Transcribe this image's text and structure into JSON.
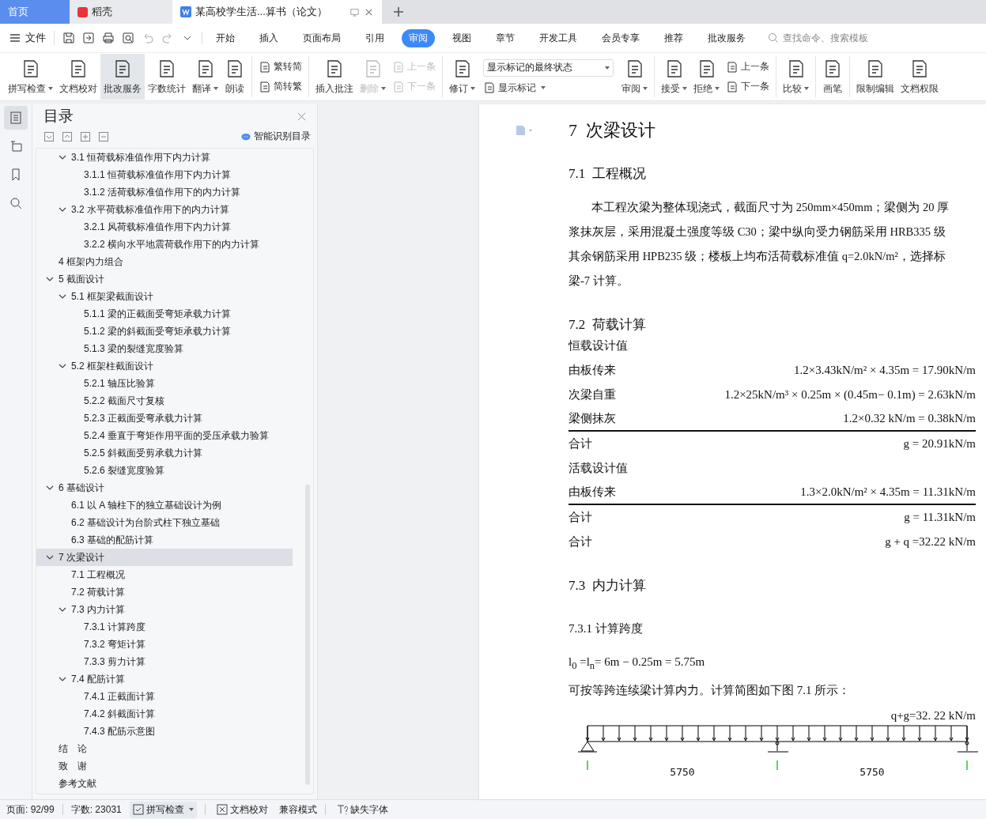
{
  "tabs": [
    {
      "label": "首页",
      "kind": "home",
      "selected": false
    },
    {
      "label": "稻壳",
      "kind": "app",
      "selected": false
    },
    {
      "label": "某高校学生活...算书（论文）",
      "kind": "doc",
      "selected": true
    }
  ],
  "menu": {
    "file": "文件",
    "tabs": [
      {
        "label": "开始",
        "selected": false
      },
      {
        "label": "插入",
        "selected": false
      },
      {
        "label": "页面布局",
        "selected": false
      },
      {
        "label": "引用",
        "selected": false
      },
      {
        "label": "审阅",
        "selected": true
      },
      {
        "label": "视图",
        "selected": false
      },
      {
        "label": "章节",
        "selected": false
      },
      {
        "label": "开发工具",
        "selected": false
      },
      {
        "label": "会员专享",
        "selected": false
      },
      {
        "label": "推荐",
        "selected": false
      },
      {
        "label": "批改服务",
        "selected": false
      }
    ],
    "search": {
      "placeholder": "查找命令、搜索模板"
    }
  },
  "ribbon": [
    {
      "kind": "large",
      "label": "拼写检查",
      "dropdown": true,
      "selected": false,
      "disabled": false
    },
    {
      "kind": "large",
      "label": "文档校对",
      "dropdown": false,
      "selected": false,
      "disabled": false
    },
    {
      "kind": "large",
      "label": "批改服务",
      "dropdown": false,
      "selected": true,
      "disabled": false
    },
    {
      "kind": "large",
      "label": "字数统计",
      "dropdown": false,
      "selected": false,
      "disabled": false
    },
    {
      "kind": "large",
      "label": "翻译",
      "dropdown": true,
      "selected": false,
      "disabled": false
    },
    {
      "kind": "large",
      "label": "朗读",
      "dropdown": false,
      "selected": false,
      "disabled": false
    },
    {
      "kind": "divider"
    },
    {
      "kind": "stack",
      "items": [
        {
          "label": "繁转简",
          "disabled": false
        },
        {
          "label": "简转繁",
          "disabled": false
        }
      ]
    },
    {
      "kind": "divider"
    },
    {
      "kind": "large",
      "label": "插入批注",
      "dropdown": false,
      "selected": false,
      "disabled": false
    },
    {
      "kind": "large",
      "label": "删除",
      "dropdown": true,
      "selected": false,
      "disabled": true
    },
    {
      "kind": "stack",
      "items": [
        {
          "label": "上一条",
          "disabled": true
        },
        {
          "label": "下一条",
          "disabled": true
        }
      ]
    },
    {
      "kind": "divider"
    },
    {
      "kind": "large",
      "label": "修订",
      "dropdown": true,
      "selected": false,
      "disabled": false
    },
    {
      "kind": "select",
      "value": "显示标记的最终状态",
      "sub": "显示标记"
    },
    {
      "kind": "large",
      "label": "审阅",
      "dropdown": true,
      "selected": false,
      "disabled": false
    },
    {
      "kind": "divider"
    },
    {
      "kind": "large",
      "label": "接受",
      "dropdown": true,
      "selected": false,
      "disabled": false
    },
    {
      "kind": "large",
      "label": "拒绝",
      "dropdown": true,
      "selected": false,
      "disabled": false
    },
    {
      "kind": "stack",
      "items": [
        {
          "label": "上一条",
          "disabled": false
        },
        {
          "label": "下一条",
          "disabled": false
        }
      ]
    },
    {
      "kind": "divider"
    },
    {
      "kind": "large",
      "label": "比较",
      "dropdown": true,
      "selected": false,
      "disabled": false
    },
    {
      "kind": "divider"
    },
    {
      "kind": "large",
      "label": "画笔",
      "dropdown": false,
      "selected": false,
      "disabled": false
    },
    {
      "kind": "divider"
    },
    {
      "kind": "large",
      "label": "限制编辑",
      "dropdown": false,
      "selected": false,
      "disabled": false
    },
    {
      "kind": "large",
      "label": "文档权限",
      "dropdown": false,
      "selected": false,
      "disabled": false
    }
  ],
  "rail": [
    {
      "selected": true
    },
    {
      "selected": false
    },
    {
      "selected": false
    },
    {
      "selected": false
    }
  ],
  "outline": {
    "title": "目录",
    "smart": "智能识别目录",
    "toc": [
      {
        "children": [
          {
            "label": "3.1 恒荷载标准值作用下内力计算",
            "selected": false,
            "expanded": true,
            "children": [
              {
                "label": "3.1.1 恒荷载标准值作用下内力计算",
                "selected": false
              },
              {
                "label": "3.1.2 活荷载标准值作用下的内力计算",
                "selected": false
              }
            ]
          },
          {
            "label": "3.2 水平荷载标准值作用下的内力计算",
            "selected": false,
            "expanded": true,
            "children": [
              {
                "label": "3.2.1 风荷载标准值作用下内力计算",
                "selected": false
              },
              {
                "label": "3.2.2 横向水平地震荷载作用下的内力计算",
                "selected": false
              }
            ]
          }
        ]
      },
      {
        "label": "4 框架内力组合",
        "selected": false
      },
      {
        "label": "5 截面设计",
        "selected": false,
        "expanded": true,
        "children": [
          {
            "label": "5.1 框架梁截面设计",
            "selected": false,
            "expanded": true,
            "children": [
              {
                "label": "5.1.1 梁的正截面受弯矩承载力计算",
                "selected": false
              },
              {
                "label": "5.1.2 梁的斜截面受弯矩承载力计算",
                "selected": false
              },
              {
                "label": "5.1.3 梁的裂缝宽度验算",
                "selected": false
              }
            ]
          },
          {
            "label": "5.2 框架柱截面设计",
            "selected": false,
            "expanded": true,
            "children": [
              {
                "label": "5.2.1 轴压比验算",
                "selected": false
              },
              {
                "label": "5.2.2 截面尺寸复核",
                "selected": false
              },
              {
                "label": "5.2.3 正截面受弯承载力计算",
                "selected": false
              },
              {
                "label": "5.2.4 垂直于弯矩作用平面的受压承载力验算",
                "selected": false
              },
              {
                "label": "5.2.5 斜截面受剪承载力计算",
                "selected": false
              },
              {
                "label": "5.2.6 裂缝宽度验算",
                "selected": false
              }
            ]
          }
        ]
      },
      {
        "label": "6 基础设计",
        "selected": false,
        "expanded": true,
        "children": [
          {
            "label": "6.1 以 A 轴柱下的独立基础设计为例",
            "selected": false
          },
          {
            "label": "6.2 基础设计为台阶式柱下独立基础",
            "selected": false
          },
          {
            "label": "6.3 基础的配筋计算",
            "selected": false
          }
        ]
      },
      {
        "label": "7 次梁设计",
        "selected": true,
        "expanded": true,
        "children": [
          {
            "label": "7.1 工程概况",
            "selected": false
          },
          {
            "label": "7.2 荷载计算",
            "selected": false
          },
          {
            "label": "7.3 内力计算",
            "selected": false,
            "expanded": true,
            "children": [
              {
                "label": "7.3.1 计算跨度",
                "selected": false
              },
              {
                "label": "7.3.2 弯矩计算",
                "selected": false
              },
              {
                "label": "7.3.3 剪力计算",
                "selected": false
              }
            ]
          },
          {
            "label": "7.4 配筋计算",
            "selected": false,
            "expanded": true,
            "children": [
              {
                "label": "7.4.1 正截面计算",
                "selected": false
              },
              {
                "label": "7.4.2 斜截面计算",
                "selected": false
              },
              {
                "label": "7.4.3 配筋示意图",
                "selected": false
              }
            ]
          }
        ]
      },
      {
        "label": "结　论",
        "selected": false
      },
      {
        "label": "致　谢",
        "selected": false
      },
      {
        "label": "参考文献",
        "selected": false
      }
    ]
  },
  "document": {
    "chapter": "7  次梁设计",
    "s1": {
      "heading": "7.1  工程概况",
      "lines": [
        "本工程次梁为整体现浇式，截面尺寸为 250mm×450mm；梁侧为 20 厚",
        "浆抹灰层，采用混凝土强度等级 C30；梁中纵向受力钢筋采用 HRB335 级",
        "其余钢筋采用 HPB235 级；楼板上均布活荷载标准值 q=2.0kN/m²，选择标",
        "梁-7 计算。"
      ]
    },
    "s2": {
      "heading": "7.2  荷载计算",
      "rows": [
        {
          "label": "恒载设计值",
          "formula": "",
          "underlined": false
        },
        {
          "label": "由板传来",
          "formula": "1.2×3.43kN/m² × 4.35m = 17.90kN/m",
          "underlined": false
        },
        {
          "label": "次梁自重",
          "formula": "1.2×25kN/m³ × 0.25m × (0.45m− 0.1m) = 2.63kN/m",
          "underlined": false
        },
        {
          "label": "梁侧抹灰",
          "formula": "1.2×0.32 kN/m = 0.38kN/m",
          "underlined": true
        },
        {
          "label": "合计",
          "formula": "g = 20.91kN/m",
          "underlined": false
        },
        {
          "label": "活载设计值",
          "formula": "",
          "underlined": false
        },
        {
          "label": "由板传来",
          "formula": "1.3×2.0kN/m² × 4.35m = 11.31kN/m",
          "underlined": true
        },
        {
          "label": "合计",
          "formula": "g = 11.31kN/m",
          "underlined": false
        },
        {
          "label": "合计",
          "formula": "g + q =32.22 kN/m",
          "underlined": false
        }
      ]
    },
    "s3": {
      "heading": "7.3  内力计算",
      "sub": "7.3.1 计算跨度",
      "formula": "l$_{0}$  =l$_{n}$= 6m − 0.25m = 5.75m",
      "text": "可按等跨连续梁计算内力。计算简图如下图 7.1 所示：",
      "load_label": "q+g=32. 22  kN/m",
      "spans": [
        "5750",
        "5750"
      ]
    }
  },
  "status": {
    "page": "页面: 92/99",
    "words": "字数: 23031",
    "spell": "拼写检查",
    "proof": "文档校对",
    "mode": "兼容模式",
    "fonts": "缺失字体"
  }
}
